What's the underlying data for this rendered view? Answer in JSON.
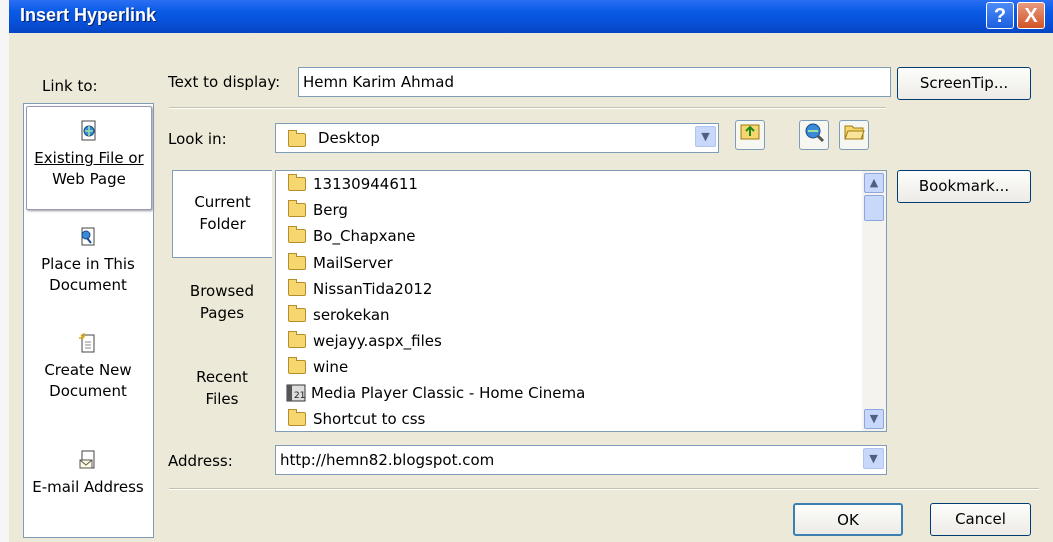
{
  "dialog": {
    "title": "Insert Hyperlink",
    "help_button": "?",
    "close_button": "X"
  },
  "link_to": {
    "label": "Link to:",
    "items": [
      {
        "line1": "Existing File or",
        "line2": "Web Page",
        "icon": "file-web-icon",
        "selected": true
      },
      {
        "line1": "Place in This",
        "line2": "Document",
        "icon": "document-place-icon"
      },
      {
        "line1": "Create New",
        "line2": "Document",
        "icon": "new-document-icon"
      },
      {
        "line1": "E-mail Address",
        "line2": "",
        "icon": "email-icon"
      }
    ]
  },
  "text_to_display": {
    "label": "Text to display:",
    "value": "Hemn Karim Ahmad"
  },
  "screentip_button": "ScreenTip...",
  "look_in": {
    "label": "Look in:",
    "value": "Desktop"
  },
  "bookmark_button": "Bookmark...",
  "tabs": [
    {
      "line1": "Current",
      "line2": "Folder",
      "selected": true
    },
    {
      "line1": "Browsed",
      "line2": "Pages"
    },
    {
      "line1": "Recent",
      "line2": "Files"
    }
  ],
  "files": [
    {
      "name": "13130944611",
      "icon": "folder-icon"
    },
    {
      "name": "Berg",
      "icon": "folder-icon"
    },
    {
      "name": "Bo_Chapxane",
      "icon": "folder-icon"
    },
    {
      "name": "MailServer",
      "icon": "folder-icon"
    },
    {
      "name": "NissanTida2012",
      "icon": "folder-icon"
    },
    {
      "name": "serokekan",
      "icon": "folder-icon"
    },
    {
      "name": "wejayy.aspx_files",
      "icon": "folder-icon"
    },
    {
      "name": "wine",
      "icon": "folder-icon"
    },
    {
      "name": "Media Player Classic - Home Cinema",
      "icon": "media-player-icon"
    },
    {
      "name": "Shortcut to css",
      "icon": "shortcut-folder-icon"
    }
  ],
  "address": {
    "label": "Address:",
    "value": "http://hemn82.blogspot.com"
  },
  "ok_button": "OK",
  "cancel_button": "Cancel"
}
